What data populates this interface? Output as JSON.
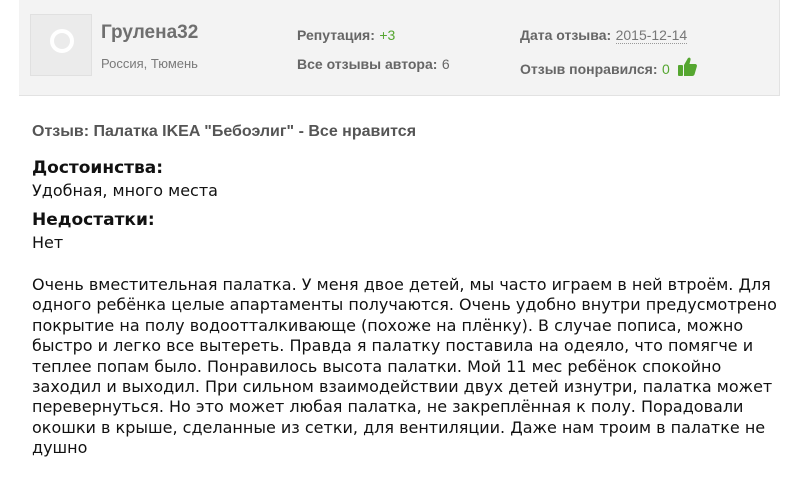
{
  "author": {
    "name": "Грулена32",
    "location": "Россия, Тюмень"
  },
  "stats": {
    "reputation_label": "Репутация:",
    "reputation_value": "+3",
    "all_reviews_label": "Все отзывы автора:",
    "all_reviews_value": "6",
    "date_label": "Дата отзыва:",
    "date_value": "2015-12-14",
    "liked_label": "Отзыв понравился:",
    "liked_value": "0",
    "thumb_icon": "thumbs-up-icon",
    "accent_color": "#55a630"
  },
  "review": {
    "title": "Отзыв: Палатка IKEA \"Бебоэлиг\" - Все нравится",
    "pros_label": "Достоинства:",
    "pros_text": "Удобная, много места",
    "cons_label": "Недостатки:",
    "cons_text": "Нет",
    "body_lines": [
      "Очень вместительная палатка. У меня двое детей, мы часто играем в ней втроём. Для",
      "одного ребёнка целые апартаменты получаются. Очень удобно внутри предусмотрено",
      "покрытие на полу водоотталкивающе (похоже на плёнку). В случае пописа, можно",
      "быстро и легко все вытереть. Правда я палатку поставила на одеяло, что помягче и",
      "теплее попам было. Понравилось высота палатки. Мой 11 мес ребёнок спокойно",
      "заходил и выходил. При сильном взаимодействии двух детей изнутри, палатка может",
      "перевернуться. Но это может любая палатка, не закреплённая к полу. Порадовали",
      "окошки в крыше, сделанные из сетки, для вентиляции. Даже нам троим в палатке не",
      "душно"
    ]
  }
}
